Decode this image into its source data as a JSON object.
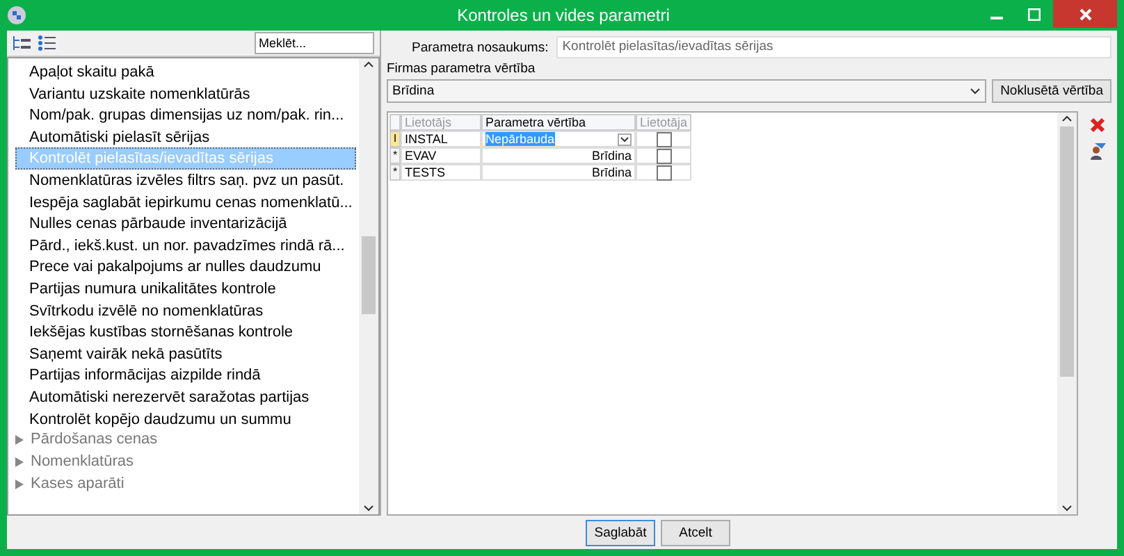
{
  "window": {
    "title": "Kontroles un vides parametri"
  },
  "search": {
    "placeholder": "Meklēt..."
  },
  "tree": [
    {
      "kind": "leaf",
      "label": "Apaļot skaitu pakā",
      "selected": false
    },
    {
      "kind": "leaf",
      "label": "Variantu uzskaite nomenklatūrās",
      "selected": false
    },
    {
      "kind": "leaf",
      "label": "Nom/pak. grupas dimensijas uz nom/pak. rin...",
      "selected": false
    },
    {
      "kind": "leaf",
      "label": "Automātiski pielasīt sērijas",
      "selected": false
    },
    {
      "kind": "leaf",
      "label": "Kontrolēt pielasītas/ievadītas sērijas",
      "selected": true
    },
    {
      "kind": "leaf",
      "label": "Nomenklatūras izvēles filtrs saņ. pvz un pasūt.",
      "selected": false
    },
    {
      "kind": "leaf",
      "label": "Iespēja saglabāt iepirkumu cenas nomenklatū...",
      "selected": false
    },
    {
      "kind": "leaf",
      "label": "Nulles cenas pārbaude inventarizācijā",
      "selected": false
    },
    {
      "kind": "leaf",
      "label": "Pārd., iekš.kust. un nor. pavadzīmes rindā rā...",
      "selected": false
    },
    {
      "kind": "leaf",
      "label": "Prece vai pakalpojums ar nulles daudzumu",
      "selected": false
    },
    {
      "kind": "leaf",
      "label": "Partijas numura unikalitātes kontrole",
      "selected": false
    },
    {
      "kind": "leaf",
      "label": "Svītrkodu izvēlē no nomenklatūras",
      "selected": false
    },
    {
      "kind": "leaf",
      "label": "Iekšējas kustības stornēšanas kontrole",
      "selected": false
    },
    {
      "kind": "leaf",
      "label": "Saņemt vairāk nekā pasūtīts",
      "selected": false
    },
    {
      "kind": "leaf",
      "label": "Partijas informācijas aizpilde rindā",
      "selected": false
    },
    {
      "kind": "leaf",
      "label": "Automātiski nerezervēt saražotas partijas",
      "selected": false
    },
    {
      "kind": "leaf",
      "label": "Kontrolēt kopējo daudzumu un summu",
      "selected": false
    },
    {
      "kind": "group",
      "label": "Pārdošanas cenas",
      "expanded": false
    },
    {
      "kind": "group",
      "label": "Nomenklatūras",
      "expanded": false
    },
    {
      "kind": "group",
      "label": "Kases aparāti",
      "expanded": false
    }
  ],
  "param_name": {
    "label": "Parametra nosaukums:",
    "value": "Kontrolēt pielasītas/ievadītas sērijas"
  },
  "company_value": {
    "label": "Firmas parametra vērtība",
    "value": "Brīdina",
    "default_button": "Noklusētā vērtība"
  },
  "grid": {
    "columns": [
      {
        "label": "Lietotājs",
        "dim": true
      },
      {
        "label": "Parametra vērtība",
        "dim": false
      },
      {
        "label": "Lietotāja",
        "dim": true
      }
    ],
    "rows": [
      {
        "marker": "I",
        "user": "INSTAL",
        "value": "Nepārbauda",
        "current": true,
        "checked": false
      },
      {
        "marker": "*",
        "user": "EVAV",
        "value": "Brīdina",
        "current": false,
        "checked": false
      },
      {
        "marker": "*",
        "user": "TESTS",
        "value": "Brīdina",
        "current": false,
        "checked": false
      }
    ]
  },
  "buttons": [
    {
      "label": "Saglabāt",
      "focused": true
    },
    {
      "label": "Atcelt",
      "focused": false
    }
  ]
}
